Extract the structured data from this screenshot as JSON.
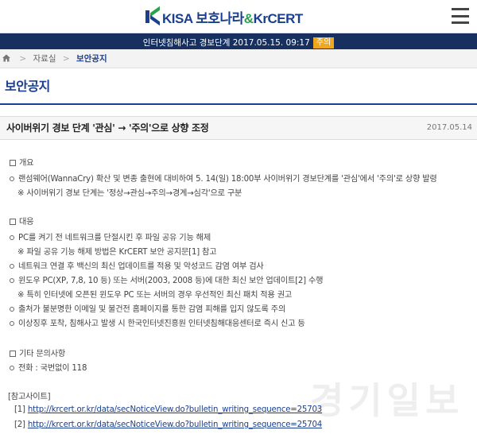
{
  "header": {
    "logo_kisa": "KISA",
    "logo_bohonara": "보호나라",
    "logo_amp": "&",
    "logo_krcert": "KrCERT",
    "menu_icon": "hamburger-icon"
  },
  "alert": {
    "text": "인터넷침해사고 경보단계 2017.05.15. 09:17",
    "level": "주의",
    "level_color": "#f0a81f"
  },
  "breadcrumb": {
    "home_icon": "home-icon",
    "sep": ">",
    "items": [
      "자료실",
      "보안공지"
    ]
  },
  "page": {
    "title": "보안공지"
  },
  "post": {
    "title": "사이버위기 경보 단계 '관심' → '주의'으로 상향 조정",
    "date": "2017.05.14",
    "sections": [
      {
        "heading": "개요",
        "items": [
          {
            "type": "item",
            "text": "랜섬웨어(WannaCry) 확산 및 변종 출현에 대비하여 5. 14(일) 18:00부 사이버위기 경보단계를 '관심'에서 '주의'로 상향 발령"
          },
          {
            "type": "note",
            "text": "※ 사이버위기 경보 단계는 '정상→관심→주의→경계→심각'으로 구분"
          }
        ]
      },
      {
        "heading": "대응",
        "items": [
          {
            "type": "item",
            "text": "PC를 켜기 전 네트워크를 단절시킨 후 파일 공유 기능 해제"
          },
          {
            "type": "note",
            "text": "※ 파일 공유 기능 해제 방법은 KrCERT 보안 공지문[1] 참고"
          },
          {
            "type": "item",
            "text": "네트워크 연결 후 백신의 최신 업데이트를 적용 및 악성코드 감염 여부 검사"
          },
          {
            "type": "item",
            "text": "윈도우 PC(XP, 7,8, 10 등) 또는 서버(2003, 2008 등)에 대한 최신 보안 업데이트[2] 수행"
          },
          {
            "type": "note",
            "text": "※ 특히 인터넷에 오픈된 윈도우 PC 또는 서버의 경우 우선적인 최신 패치 적용 권고"
          },
          {
            "type": "item",
            "text": "출처가 불분명한 이메일 및 불건전 홈페이지를 통한 감염 피해를 입지 않도록 주의"
          },
          {
            "type": "item",
            "text": "이상징후 포착, 침해사고 발생 시 한국인터넷진흥원 인터넷침해대응센터로 즉시 신고 등"
          }
        ]
      },
      {
        "heading": "기타 문의사항",
        "items": [
          {
            "type": "item",
            "text": "전화 : 국번없이 118"
          }
        ]
      }
    ],
    "refs_heading": "[참고사이트]",
    "refs": [
      {
        "label": "[1]",
        "url": "http://krcert.or.kr/data/secNoticeView.do?bulletin_writing_sequence=25703"
      },
      {
        "label": "[2]",
        "url": "http://krcert.or.kr/data/secNoticeView.do?bulletin_writing_sequence=25704"
      }
    ]
  },
  "watermark": "경기일보"
}
